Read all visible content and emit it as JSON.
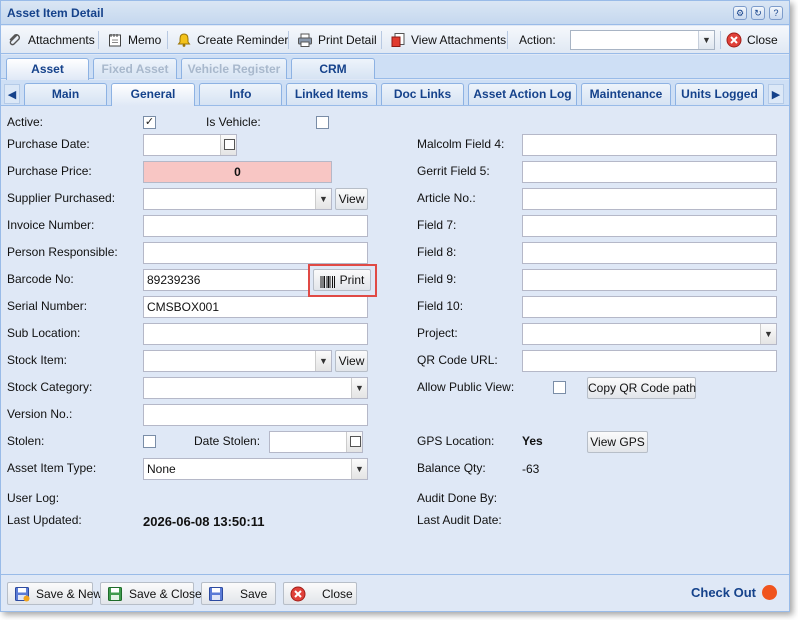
{
  "window": {
    "title": "Asset Item Detail"
  },
  "toolbar": {
    "attachments": "Attachments",
    "memo": "Memo",
    "create_reminder": "Create Reminder",
    "print_detail": "Print Detail",
    "view_attachments": "View Attachments",
    "action_label": "Action:",
    "action_value": "",
    "close": "Close"
  },
  "main_tabs": [
    {
      "label": "Asset",
      "state": "active"
    },
    {
      "label": "Fixed Asset",
      "state": "disabled"
    },
    {
      "label": "Vehicle Register",
      "state": "disabled"
    },
    {
      "label": "CRM",
      "state": "normal"
    }
  ],
  "sub_tabs": [
    {
      "label": "Main"
    },
    {
      "label": "General",
      "state": "active"
    },
    {
      "label": "Info"
    },
    {
      "label": "Linked Items"
    },
    {
      "label": "Doc Links"
    },
    {
      "label": "Asset Action Log"
    },
    {
      "label": "Maintenance"
    },
    {
      "label": "Units Logged"
    }
  ],
  "left": {
    "active": {
      "label": "Active:",
      "checked": true
    },
    "is_vehicle": {
      "label": "Is Vehicle:",
      "checked": false
    },
    "purchase_date": {
      "label": "Purchase Date:",
      "value": ""
    },
    "purchase_price": {
      "label": "Purchase Price:",
      "value": "0"
    },
    "supplier_purchased": {
      "label": "Supplier Purchased:",
      "value": "",
      "view": "View"
    },
    "invoice_number": {
      "label": "Invoice Number:",
      "value": ""
    },
    "person_responsible": {
      "label": "Person Responsible:",
      "value": ""
    },
    "barcode_no": {
      "label": "Barcode No:",
      "value": "89239236",
      "print": "Print"
    },
    "serial_number": {
      "label": "Serial Number:",
      "value": "CMSBOX001"
    },
    "sub_location": {
      "label": "Sub Location:",
      "value": ""
    },
    "stock_item": {
      "label": "Stock Item:",
      "value": "",
      "view": "View"
    },
    "stock_category": {
      "label": "Stock Category:",
      "value": ""
    },
    "version_no": {
      "label": "Version No.:",
      "value": ""
    },
    "stolen": {
      "label": "Stolen:",
      "checked": false
    },
    "date_stolen": {
      "label": "Date Stolen:",
      "value": ""
    },
    "asset_item_type": {
      "label": "Asset Item Type:",
      "value": "None"
    },
    "user_log": {
      "label": "User Log:",
      "value": ""
    },
    "last_updated": {
      "label": "Last Updated:",
      "value": "2026-06-08 13:50:11"
    }
  },
  "right": {
    "malcolm_field_4": {
      "label": "Malcolm Field 4:",
      "value": ""
    },
    "gerrit_field_5": {
      "label": "Gerrit Field 5:",
      "value": ""
    },
    "article_no": {
      "label": "Article No.:",
      "value": ""
    },
    "field_7": {
      "label": "Field 7:",
      "value": ""
    },
    "field_8": {
      "label": "Field 8:",
      "value": ""
    },
    "field_9": {
      "label": "Field 9:",
      "value": ""
    },
    "field_10": {
      "label": "Field 10:",
      "value": ""
    },
    "project": {
      "label": "Project:",
      "value": ""
    },
    "qr_code_url": {
      "label": "QR Code URL:",
      "value": ""
    },
    "allow_public_view": {
      "label": "Allow Public View:",
      "checked": false,
      "button": "Copy QR Code path"
    },
    "gps_location": {
      "label": "GPS Location:",
      "value": "Yes",
      "button": "View GPS"
    },
    "balance_qty": {
      "label": "Balance Qty:",
      "value": "-63"
    },
    "audit_done_by": {
      "label": "Audit Done By:",
      "value": ""
    },
    "last_audit_date": {
      "label": "Last Audit Date:",
      "value": ""
    }
  },
  "footer": {
    "save_new": "Save & New",
    "save_close": "Save & Close",
    "save": "Save",
    "close": "Close",
    "check_out": "Check Out",
    "check_out_color": "#f0541e"
  },
  "colors": {
    "window_bg": "#dfe8f6",
    "title_text": "#15428b",
    "purchase_price_bg": "#f8c6c4",
    "highlight_border": "#e04a45"
  }
}
